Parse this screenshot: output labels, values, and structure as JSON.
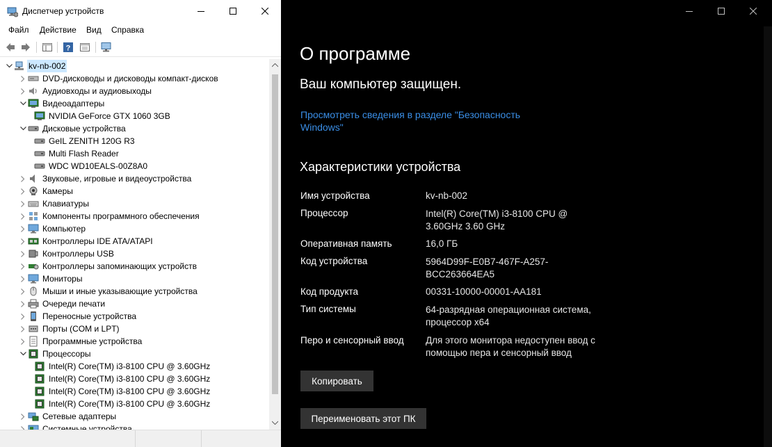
{
  "device_manager": {
    "title": "Диспетчер устройств",
    "menu": [
      "Файл",
      "Действие",
      "Вид",
      "Справка"
    ],
    "tree": [
      {
        "label": "kv-nb-002",
        "level": 0,
        "expanded": true,
        "icon": "computer-root-icon"
      },
      {
        "label": "DVD-дисководы и дисководы компакт-дисков",
        "level": 1,
        "expanded": false,
        "icon": "dvd-icon"
      },
      {
        "label": "Аудиовходы и аудиовыходы",
        "level": 1,
        "expanded": false,
        "icon": "audio-icon"
      },
      {
        "label": "Видеоадаптеры",
        "level": 1,
        "expanded": true,
        "icon": "display-adapter-icon"
      },
      {
        "label": "NVIDIA GeForce GTX 1060 3GB",
        "level": 2,
        "icon": "display-adapter-icon"
      },
      {
        "label": "Дисковые устройства",
        "level": 1,
        "expanded": true,
        "icon": "disk-icon"
      },
      {
        "label": "GeIL ZENITH 120G R3",
        "level": 2,
        "icon": "disk-icon"
      },
      {
        "label": "Multi Flash Reader",
        "level": 2,
        "icon": "disk-icon"
      },
      {
        "label": "WDC WD10EALS-00Z8A0",
        "level": 2,
        "icon": "disk-icon"
      },
      {
        "label": "Звуковые, игровые и видеоустройства",
        "level": 1,
        "expanded": false,
        "icon": "speaker-icon"
      },
      {
        "label": "Камеры",
        "level": 1,
        "expanded": false,
        "icon": "camera-icon"
      },
      {
        "label": "Клавиатуры",
        "level": 1,
        "expanded": false,
        "icon": "keyboard-icon"
      },
      {
        "label": "Компоненты программного обеспечения",
        "level": 1,
        "expanded": false,
        "icon": "software-component-icon"
      },
      {
        "label": "Компьютер",
        "level": 1,
        "expanded": false,
        "icon": "monitor-icon"
      },
      {
        "label": "Контроллеры IDE ATA/ATAPI",
        "level": 1,
        "expanded": false,
        "icon": "ide-controller-icon"
      },
      {
        "label": "Контроллеры USB",
        "level": 1,
        "expanded": false,
        "icon": "usb-icon"
      },
      {
        "label": "Контроллеры запоминающих устройств",
        "level": 1,
        "expanded": false,
        "icon": "storage-controller-icon"
      },
      {
        "label": "Мониторы",
        "level": 1,
        "expanded": false,
        "icon": "monitor-icon"
      },
      {
        "label": "Мыши и иные указывающие устройства",
        "level": 1,
        "expanded": false,
        "icon": "mouse-icon"
      },
      {
        "label": "Очереди печати",
        "level": 1,
        "expanded": false,
        "icon": "printer-icon"
      },
      {
        "label": "Переносные устройства",
        "level": 1,
        "expanded": false,
        "icon": "portable-device-icon"
      },
      {
        "label": "Порты (COM и LPT)",
        "level": 1,
        "expanded": false,
        "icon": "port-icon"
      },
      {
        "label": "Программные устройства",
        "level": 1,
        "expanded": false,
        "icon": "software-device-icon"
      },
      {
        "label": "Процессоры",
        "level": 1,
        "expanded": true,
        "icon": "processor-icon"
      },
      {
        "label": "Intel(R) Core(TM) i3-8100 CPU @ 3.60GHz",
        "level": 2,
        "icon": "processor-icon"
      },
      {
        "label": "Intel(R) Core(TM) i3-8100 CPU @ 3.60GHz",
        "level": 2,
        "icon": "processor-icon"
      },
      {
        "label": "Intel(R) Core(TM) i3-8100 CPU @ 3.60GHz",
        "level": 2,
        "icon": "processor-icon"
      },
      {
        "label": "Intel(R) Core(TM) i3-8100 CPU @ 3.60GHz",
        "level": 2,
        "icon": "processor-icon"
      },
      {
        "label": "Сетевые адаптеры",
        "level": 1,
        "expanded": false,
        "icon": "network-adapter-icon"
      },
      {
        "label": "Системные устройства",
        "level": 1,
        "expanded": false,
        "icon": "system-device-icon"
      }
    ]
  },
  "about": {
    "title": "О программе",
    "protected": "Ваш компьютер защищен.",
    "security_link": "Просмотреть сведения в разделе \"Безопасность Windows\"",
    "specs_heading": "Характеристики устройства",
    "specs": [
      {
        "label": "Имя устройства",
        "value": "kv-nb-002"
      },
      {
        "label": "Процессор",
        "value": "Intel(R) Core(TM) i3-8100 CPU @ 3.60GHz 3.60 GHz"
      },
      {
        "label": "Оперативная память",
        "value": "16,0 ГБ"
      },
      {
        "label": "Код устройства",
        "value": "5964D99F-E0B7-467F-A257-BCC263664EA5"
      },
      {
        "label": "Код продукта",
        "value": "00331-10000-00001-AA181"
      },
      {
        "label": "Тип системы",
        "value": "64-разрядная операционная система, процессор x64"
      },
      {
        "label": "Перо и сенсорный ввод",
        "value": "Для этого монитора недоступен ввод с помощью пера и сенсорный ввод"
      }
    ],
    "copy_button": "Копировать",
    "rename_button": "Переименовать этот ПК"
  },
  "colors": {
    "link": "#3a8ee6",
    "selection": "#cce8ff",
    "button_bg": "#333333",
    "about_bg": "#000000"
  }
}
